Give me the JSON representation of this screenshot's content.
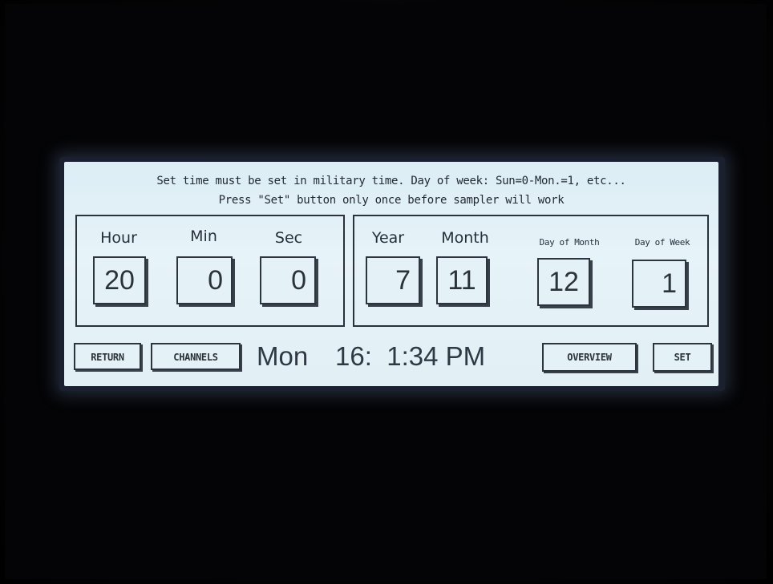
{
  "notice": {
    "line1": "Set time must be set in military time.  Day of week: Sun=0-Mon.=1, etc...",
    "line2": "Press \"Set\" button only once  before sampler will work"
  },
  "time_group": {
    "hour_label": "Hour",
    "min_label": "Min",
    "sec_label": "Sec",
    "hour_value": "20",
    "min_value": "0",
    "sec_value": "0"
  },
  "date_group": {
    "year_label": "Year",
    "month_label": "Month",
    "day_of_month_label": "Day of Month",
    "day_of_week_label": "Day of Week",
    "year_value": "7",
    "month_value": "11",
    "day_of_month_value": "12",
    "day_of_week_value": "1"
  },
  "footer": {
    "return_label": "RETURN",
    "channels_label": "CHANNELS",
    "clock_day": "Mon",
    "clock_time": "16:  1:34 PM",
    "overview_label": "OVERVIEW",
    "set_label": "SET"
  }
}
